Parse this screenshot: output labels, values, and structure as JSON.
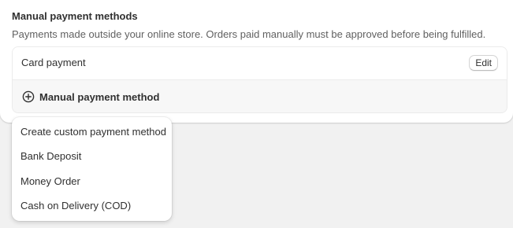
{
  "section": {
    "title": "Manual payment methods",
    "description": "Payments made outside your online store. Orders paid manually must be approved before being fulfilled."
  },
  "methods": {
    "items": [
      {
        "name": "Card payment",
        "action_label": "Edit"
      }
    ],
    "add_label": "Manual payment method",
    "add_icon": "plus-circle-icon"
  },
  "dropdown": {
    "options": [
      "Create custom payment method",
      "Bank Deposit",
      "Money Order",
      "Cash on Delivery (COD)"
    ]
  }
}
